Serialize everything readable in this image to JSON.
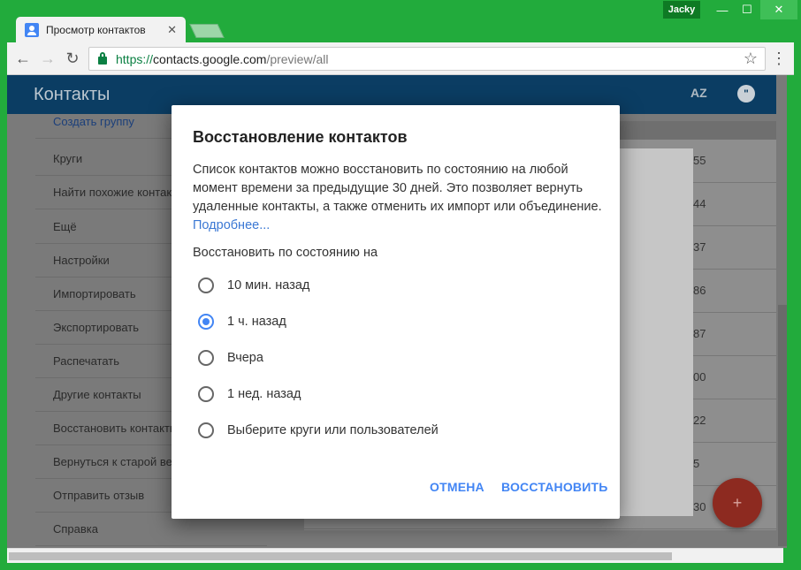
{
  "window": {
    "user": "Jacky",
    "controls": {
      "minimize": "—",
      "maximize": "☐",
      "close": "✕"
    }
  },
  "tab": {
    "title": "Просмотр контактов",
    "close": "✕"
  },
  "toolbar": {
    "url_scheme": "https://",
    "url_host": "contacts.google.com",
    "url_path": "/preview/all",
    "back": "←",
    "forward": "→",
    "reload": "↻",
    "star": "☆",
    "menu": "⋮"
  },
  "app": {
    "title": "Контакты",
    "sort_label": "AZ",
    "chat_label": "\"",
    "fab": "+"
  },
  "sidebar": {
    "items": [
      {
        "label": "Создать группу"
      },
      {
        "label": "Круги"
      },
      {
        "label": "Найти похожие контакты"
      },
      {
        "label": "Ещё"
      },
      {
        "label": "Настройки"
      },
      {
        "label": "Импортировать"
      },
      {
        "label": "Экспортировать"
      },
      {
        "label": "Распечатать"
      },
      {
        "label": "Другие контакты"
      },
      {
        "label": "Восстановить контакты"
      },
      {
        "label": "Вернуться к старой версии"
      },
      {
        "label": "Отправить отзыв"
      },
      {
        "label": "Справка"
      }
    ]
  },
  "list": {
    "numbers": [
      "55",
      "44",
      "37",
      "86",
      "87",
      "00",
      "22",
      "5",
      "30"
    ]
  },
  "dialog": {
    "title": "Восстановление контактов",
    "body": "Список контактов можно восстановить по состоянию на любой момент времени за предыдущие 30 дней. Это позволяет вернуть удаленные контакты, а также отменить их импорт или объединение.",
    "link": "Подробнее...",
    "subtitle": "Восстановить по состоянию на",
    "options": [
      {
        "label": "10 мин. назад",
        "selected": false
      },
      {
        "label": "1 ч. назад",
        "selected": true
      },
      {
        "label": "Вчера",
        "selected": false
      },
      {
        "label": "1 нед. назад",
        "selected": false
      },
      {
        "label": "Выберите круги или пользователей",
        "selected": false
      }
    ],
    "cancel": "ОТМЕНА",
    "restore": "ВОССТАНОВИТЬ"
  },
  "colors": {
    "accent": "#4285f4",
    "appbar": "#0b3d63",
    "window": "#22ab3c"
  }
}
